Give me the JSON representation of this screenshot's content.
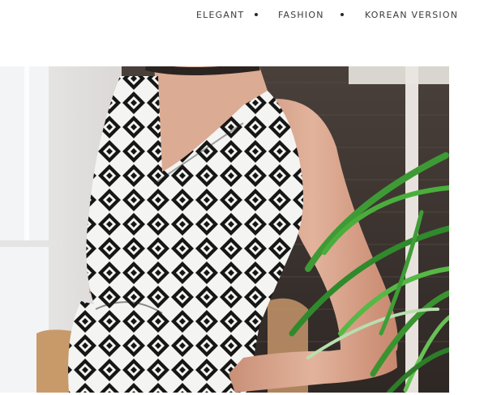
{
  "tags": [
    {
      "label": "ELEGANT"
    },
    {
      "label": "FASHION"
    },
    {
      "label": "KOREAN VERSION"
    }
  ],
  "separator": "•",
  "photo": {
    "subject": "product-photo",
    "colors": {
      "wall": "#d9d6d3",
      "window": "#f2f3f4",
      "screen": "#3b3431",
      "skin": "#d9a58d",
      "dress_dark": "#161616",
      "dress_light": "#f4f4f2",
      "plant": "#3e9a35"
    }
  }
}
